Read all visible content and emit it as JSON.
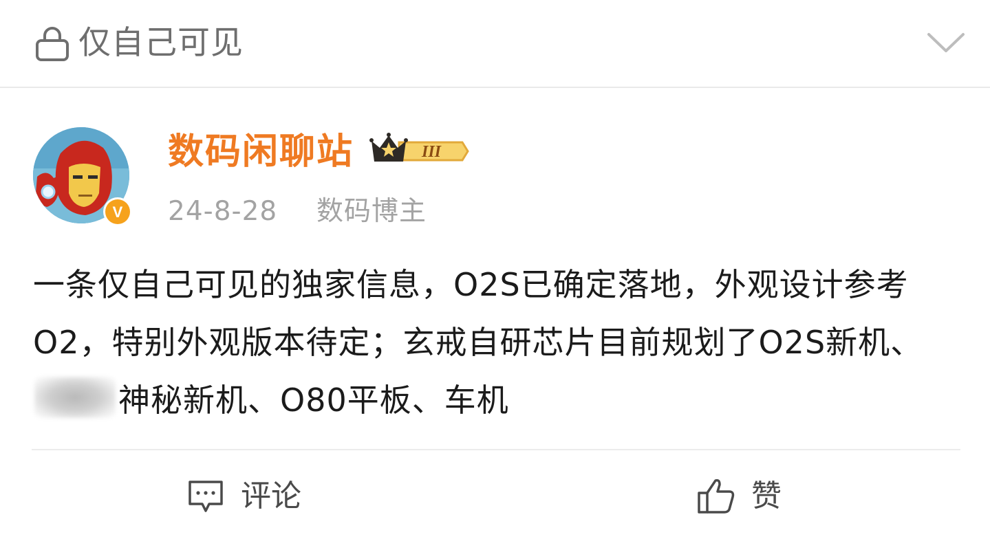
{
  "header": {
    "privacy_label": "仅自己可见",
    "lock_icon": "lock-icon",
    "expand_icon": "chevron-down-icon"
  },
  "author": {
    "name": "数码闲聊站",
    "name_color": "#ef7a22",
    "date": "24-8-28",
    "tag": "数码博主",
    "vip_level": "III",
    "verified_mark": "V"
  },
  "post": {
    "text_part1": "一条仅自己可见的独家信息，O2S已确定落地，外观设计参考O2，特别外观版本待定；玄戒自研芯片目前规划了O2S新机、",
    "text_part2": "神秘新机、O80平板、车机"
  },
  "actions": {
    "comment_label": "评论",
    "like_label": "赞"
  }
}
